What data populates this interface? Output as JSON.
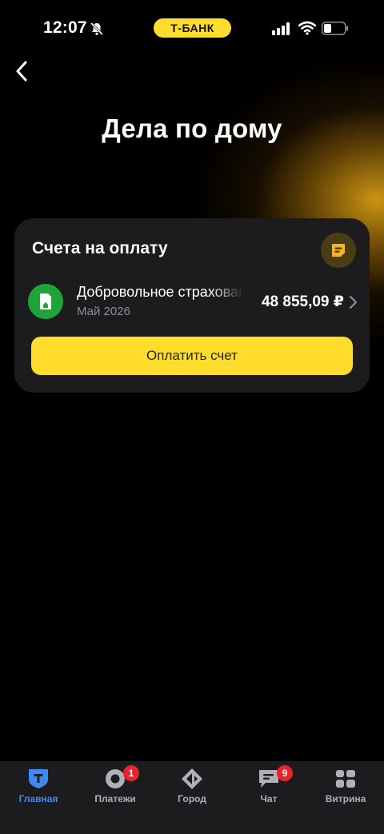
{
  "status_bar": {
    "time": "12:07",
    "brand": "Т-БАНК",
    "icons": [
      "bell-off-icon",
      "signal-icon",
      "wifi-icon",
      "battery-icon"
    ]
  },
  "header": {
    "back_icon": "chevron-left-icon",
    "title": "Дела по дому"
  },
  "bills_card": {
    "title": "Счета на оплату",
    "action_icon": "document-icon",
    "bill": {
      "icon": "house-document-icon",
      "name": "Добровольное страхование",
      "date": "Май 2026",
      "amount": "48 855,09 ₽"
    },
    "pay_button_label": "Оплатить счет"
  },
  "tab_bar": {
    "tabs": [
      {
        "label": "Главная",
        "icon": "tbank-logo-icon",
        "active": true,
        "badge": ""
      },
      {
        "label": "Платежи",
        "icon": "payments-icon",
        "active": false,
        "badge": "1"
      },
      {
        "label": "Город",
        "icon": "city-icon",
        "active": false,
        "badge": ""
      },
      {
        "label": "Чат",
        "icon": "chat-icon",
        "active": false,
        "badge": "9"
      },
      {
        "label": "Витрина",
        "icon": "showcase-icon",
        "active": false,
        "badge": ""
      }
    ]
  },
  "colors": {
    "accent_yellow": "#ffdd2d",
    "active_tab": "#3d8bf2",
    "badge_red": "#e8222e",
    "bill_icon_green": "#1ea43a",
    "card_bg": "#1c1c1e"
  }
}
